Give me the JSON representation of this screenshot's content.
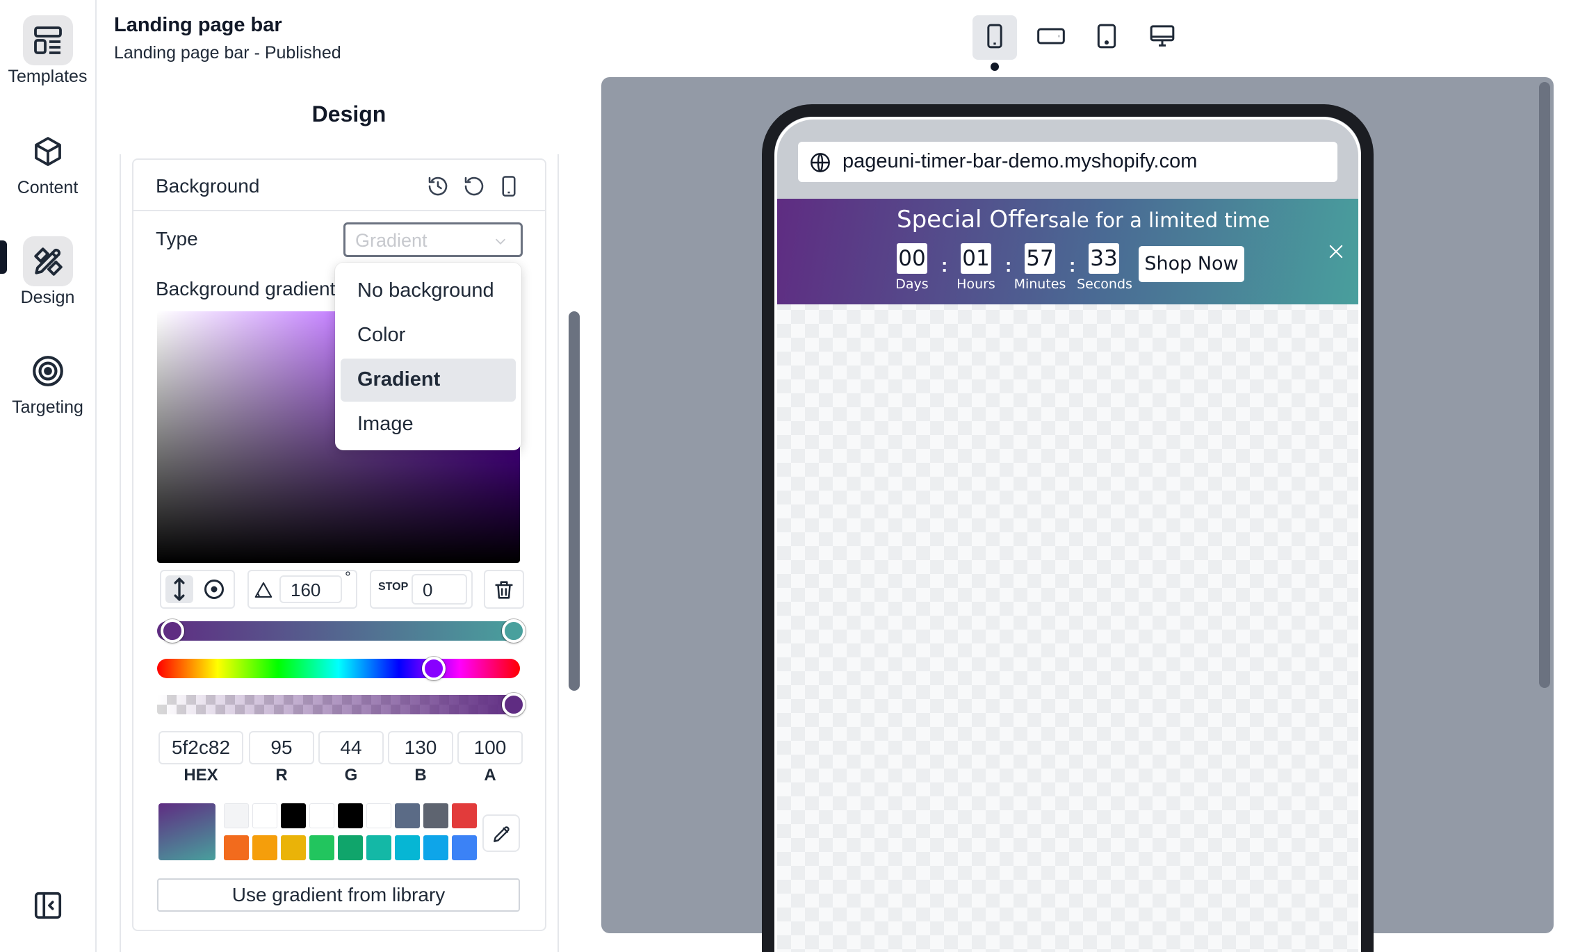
{
  "app": {
    "title": "Landing page bar",
    "subtitle": "Landing page bar - Published"
  },
  "rail": {
    "items": [
      {
        "label": "Templates",
        "icon": "templates-icon"
      },
      {
        "label": "Content",
        "icon": "cube-icon"
      },
      {
        "label": "Design",
        "icon": "design-icon",
        "active": true
      },
      {
        "label": "Targeting",
        "icon": "target-icon"
      }
    ],
    "collapse_icon": "sidebar-collapse-icon"
  },
  "panel": {
    "heading": "Design",
    "section": {
      "label": "Background",
      "icons": [
        "history-icon",
        "reset-icon",
        "mobile-icon"
      ]
    },
    "type": {
      "label": "Type",
      "value": "Gradient",
      "options": [
        "No background",
        "Color",
        "Gradient",
        "Image"
      ],
      "selected": "Gradient"
    },
    "gradient_label": "Background gradient",
    "angle": "160",
    "degree_symbol": "°",
    "stop_label": "STOP",
    "stop_value": "0",
    "hex": {
      "value": "5f2c82",
      "caption": "HEX"
    },
    "r": {
      "value": "95",
      "caption": "R"
    },
    "g": {
      "value": "44",
      "caption": "G"
    },
    "b": {
      "value": "130",
      "caption": "B"
    },
    "a": {
      "value": "100",
      "caption": "A"
    },
    "colors": {
      "gradient_start": "#5f2c82",
      "gradient_end": "#49a09d"
    },
    "swatches_row1": [
      "#f3f4f6",
      "#ffffff",
      "#000000",
      "#ffffff",
      "#000000",
      "#ffffff",
      "#5b6b86",
      "#5e6470",
      "#e23b3b"
    ],
    "swatches_row2": [
      "#f26b1d",
      "#f59e0b",
      "#eab308",
      "#22c55e",
      "#10a56b",
      "#14b8a6",
      "#06b6d4",
      "#0ea5e9",
      "#3b82f6"
    ],
    "library_button": "Use gradient from library"
  },
  "devices": [
    "mobile-device-icon",
    "tablet-landscape-icon",
    "tablet-portrait-icon",
    "desktop-icon"
  ],
  "preview": {
    "url": "pageuni-timer-bar-demo.myshopify.com",
    "bar": {
      "title": "Special Offer",
      "subtitle": "sale for a limited time",
      "timer": [
        {
          "value": "00",
          "label": "Days"
        },
        {
          "value": "01",
          "label": "Hours"
        },
        {
          "value": "57",
          "label": "Minutes"
        },
        {
          "value": "33",
          "label": "Seconds"
        }
      ],
      "separator": ":",
      "cta": "Shop Now"
    }
  }
}
